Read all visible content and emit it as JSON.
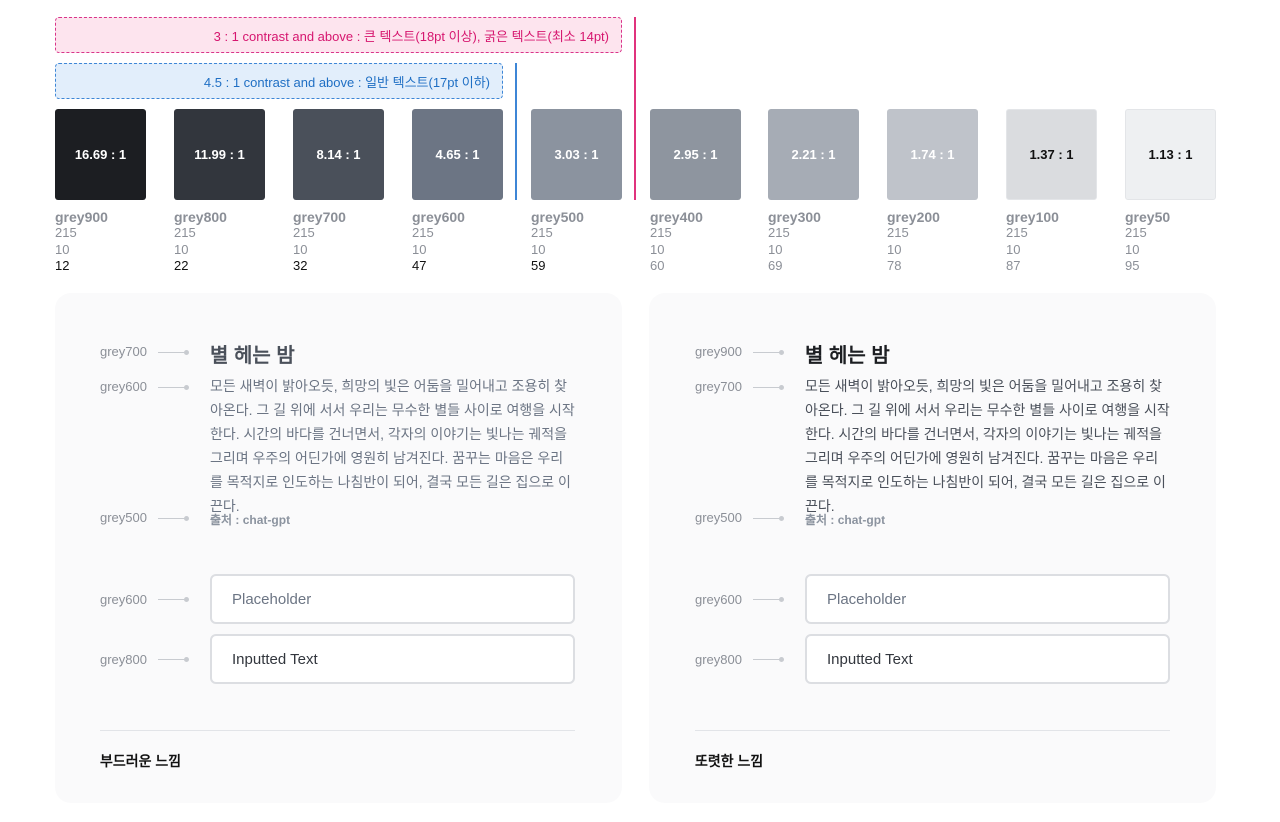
{
  "banners": {
    "large_text": "3 : 1 contrast and above : 큰 텍스트(18pt 이상), 굵은 텍스트(최소 14pt)",
    "normal_text": "4.5 : 1 contrast and above : 일반 텍스트(17pt 이하)"
  },
  "swatches": [
    {
      "name": "grey900",
      "ratio": "16.69 : 1",
      "hue": "215",
      "sat": "10",
      "light": "12",
      "bg": "#1c1e22",
      "fg": "#ffffff"
    },
    {
      "name": "grey800",
      "ratio": "11.99 : 1",
      "hue": "215",
      "sat": "10",
      "light": "22",
      "bg": "#32363d",
      "fg": "#ffffff"
    },
    {
      "name": "grey700",
      "ratio": "8.14 : 1",
      "hue": "215",
      "sat": "10",
      "light": "32",
      "bg": "#4a505a",
      "fg": "#ffffff"
    },
    {
      "name": "grey600",
      "ratio": "4.65 : 1",
      "hue": "215",
      "sat": "10",
      "light": "47",
      "bg": "#6c7584",
      "fg": "#ffffff"
    },
    {
      "name": "grey500",
      "ratio": "3.03 : 1",
      "hue": "215",
      "sat": "10",
      "light": "59",
      "bg": "#8b939f",
      "fg": "#ffffff"
    },
    {
      "name": "grey400",
      "ratio": "2.95 : 1",
      "hue": "215",
      "sat": "10",
      "light": "60",
      "bg": "#8e959f",
      "fg": "#ffffff"
    },
    {
      "name": "grey300",
      "ratio": "2.21 : 1",
      "hue": "215",
      "sat": "10",
      "light": "69",
      "bg": "#a6acb5",
      "fg": "#ffffff"
    },
    {
      "name": "grey200",
      "ratio": "1.74 : 1",
      "hue": "215",
      "sat": "10",
      "light": "78",
      "bg": "#bfc3ca",
      "fg": "#ffffff"
    },
    {
      "name": "grey100",
      "ratio": "1.37 : 1",
      "hue": "215",
      "sat": "10",
      "light": "87",
      "bg": "#dadcdf",
      "fg": "#111111"
    },
    {
      "name": "grey50",
      "ratio": "1.13 : 1",
      "hue": "215",
      "sat": "10",
      "light": "95",
      "bg": "#eef0f2",
      "fg": "#111111"
    }
  ],
  "left_card": {
    "labels": {
      "title": "grey700",
      "body": "grey600",
      "source": "grey500",
      "placeholder": "grey600",
      "input": "grey800"
    },
    "poem_title": "별 헤는 밤",
    "poem_body": "모든 새벽이 밝아오듯, 희망의 빛은 어둠을 밀어내고 조용히 찾아온다. 그 길 위에 서서 우리는 무수한 별들 사이로 여행을 시작한다. 시간의 바다를 건너면서, 각자의 이야기는 빛나는 궤적을 그리며 우주의 어딘가에 영원히 남겨진다. 꿈꾸는 마음은 우리를 목적지로 인도하는 나침반이 되어, 결국 모든 길은 집으로 이끈다.",
    "source": "출처 : chat-gpt",
    "placeholder": "Placeholder",
    "input_value": "Inputted Text",
    "caption": "부드러운 느낌",
    "colors": {
      "title": "#4a505a",
      "body": "#6c7584",
      "source": "#8b939f",
      "placeholder": "#6c7584",
      "input": "#32363d"
    }
  },
  "right_card": {
    "labels": {
      "title": "grey900",
      "body": "grey700",
      "source": "grey500",
      "placeholder": "grey600",
      "input": "grey800"
    },
    "poem_title": "별 헤는 밤",
    "poem_body": "모든 새벽이 밝아오듯, 희망의 빛은 어둠을 밀어내고 조용히 찾아온다. 그 길 위에 서서 우리는 무수한 별들 사이로 여행을 시작한다. 시간의 바다를 건너면서, 각자의 이야기는 빛나는 궤적을 그리며 우주의 어딘가에 영원히 남겨진다. 꿈꾸는 마음은 우리를 목적지로 인도하는 나침반이 되어, 결국 모든 길은 집으로 이끈다.",
    "source": "출처 : chat-gpt",
    "placeholder": "Placeholder",
    "input_value": "Inputted Text",
    "caption": "또렷한 느낌",
    "colors": {
      "title": "#1c1e22",
      "body": "#4a505a",
      "source": "#8b939f",
      "placeholder": "#6c7584",
      "input": "#32363d"
    }
  }
}
